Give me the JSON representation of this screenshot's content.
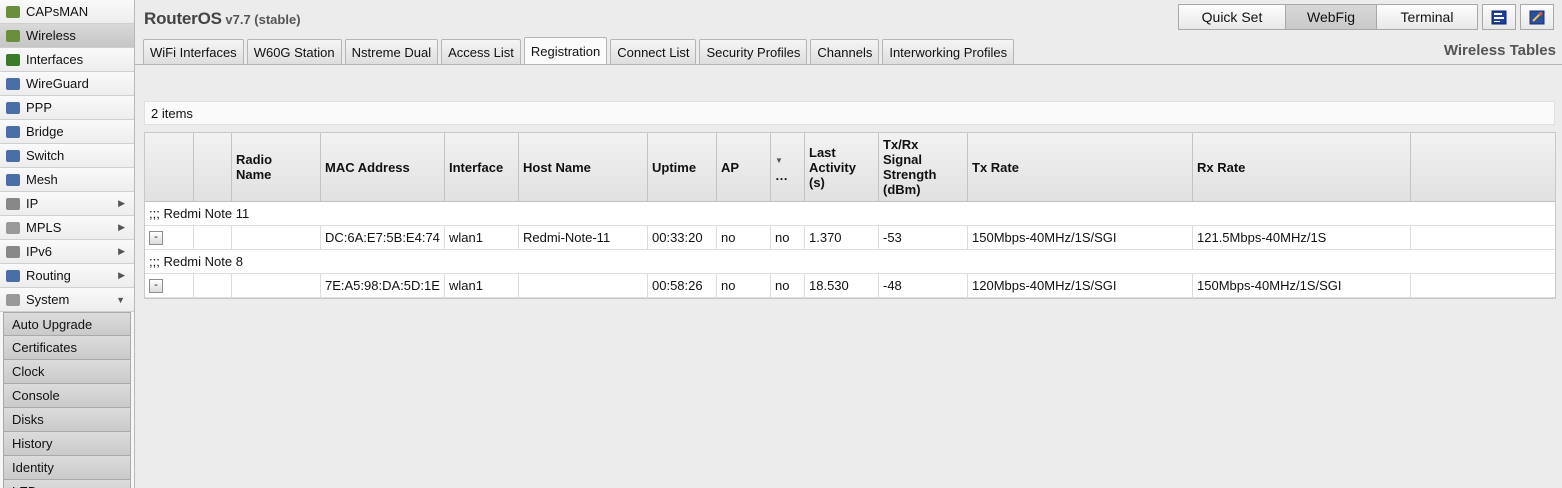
{
  "sidebar": {
    "items": [
      {
        "label": "CAPsMAN",
        "icon": "capsman-icon",
        "color": "#6a8f3a",
        "active": false,
        "arrow": ""
      },
      {
        "label": "Wireless",
        "icon": "wireless-icon",
        "color": "#6a8f3a",
        "active": true,
        "arrow": ""
      },
      {
        "label": "Interfaces",
        "icon": "interfaces-icon",
        "color": "#3a7a2a",
        "active": false,
        "arrow": ""
      },
      {
        "label": "WireGuard",
        "icon": "wireguard-icon",
        "color": "#4a6ea8",
        "active": false,
        "arrow": ""
      },
      {
        "label": "PPP",
        "icon": "ppp-icon",
        "color": "#4a6ea8",
        "active": false,
        "arrow": ""
      },
      {
        "label": "Bridge",
        "icon": "bridge-icon",
        "color": "#4a6ea8",
        "active": false,
        "arrow": ""
      },
      {
        "label": "Switch",
        "icon": "switch-icon",
        "color": "#4a6ea8",
        "active": false,
        "arrow": ""
      },
      {
        "label": "Mesh",
        "icon": "mesh-icon",
        "color": "#4a6ea8",
        "active": false,
        "arrow": ""
      },
      {
        "label": "IP",
        "icon": "ip-icon",
        "color": "#888888",
        "active": false,
        "arrow": "▶"
      },
      {
        "label": "MPLS",
        "icon": "mpls-icon",
        "color": "#999999",
        "active": false,
        "arrow": "▶"
      },
      {
        "label": "IPv6",
        "icon": "ipv6-icon",
        "color": "#888888",
        "active": false,
        "arrow": "▶"
      },
      {
        "label": "Routing",
        "icon": "routing-icon",
        "color": "#4a6ea8",
        "active": false,
        "arrow": "▶"
      },
      {
        "label": "System",
        "icon": "system-icon",
        "color": "#999999",
        "active": false,
        "arrow": "▼"
      }
    ],
    "submenu": [
      "Auto Upgrade",
      "Certificates",
      "Clock",
      "Console",
      "Disks",
      "History",
      "Identity",
      "LED"
    ]
  },
  "header": {
    "brand": "RouterOS",
    "version": "v7.7 (stable)",
    "buttons": {
      "quick_set": "Quick Set",
      "webfig": "WebFig",
      "terminal": "Terminal"
    },
    "section_title": "Wireless Tables"
  },
  "tabs": [
    "WiFi Interfaces",
    "W60G Station",
    "Nstreme Dual",
    "Access List",
    "Registration",
    "Connect List",
    "Security Profiles",
    "Channels",
    "Interworking Profiles"
  ],
  "active_tab": 4,
  "items_count": "2 items",
  "table": {
    "headers": [
      "",
      "",
      "Radio\nName",
      "MAC Address",
      "Interface",
      "Host Name",
      "Uptime",
      "AP",
      "▼\n…",
      "Last\nActivity\n(s)",
      "Tx/Rx\nSignal\nStrength\n(dBm)",
      "Tx Rate",
      "Rx Rate",
      ""
    ],
    "rows": [
      {
        "comment": ";;; Redmi Note 11",
        "button": "-",
        "cells": [
          "",
          "",
          "DC:6A:E7:5B:E4:74",
          "wlan1",
          "Redmi-Note-11",
          "00:33:20",
          "no",
          "no",
          "1.370",
          "-53",
          "150Mbps-40MHz/1S/SGI",
          "121.5Mbps-40MHz/1S",
          ""
        ]
      },
      {
        "comment": ";;; Redmi Note 8",
        "button": "-",
        "cells": [
          "",
          "",
          "7E:A5:98:DA:5D:1E",
          "wlan1",
          "",
          "00:58:26",
          "no",
          "no",
          "18.530",
          "-48",
          "120Mbps-40MHz/1S/SGI",
          "150Mbps-40MHz/1S/SGI",
          ""
        ]
      }
    ]
  }
}
